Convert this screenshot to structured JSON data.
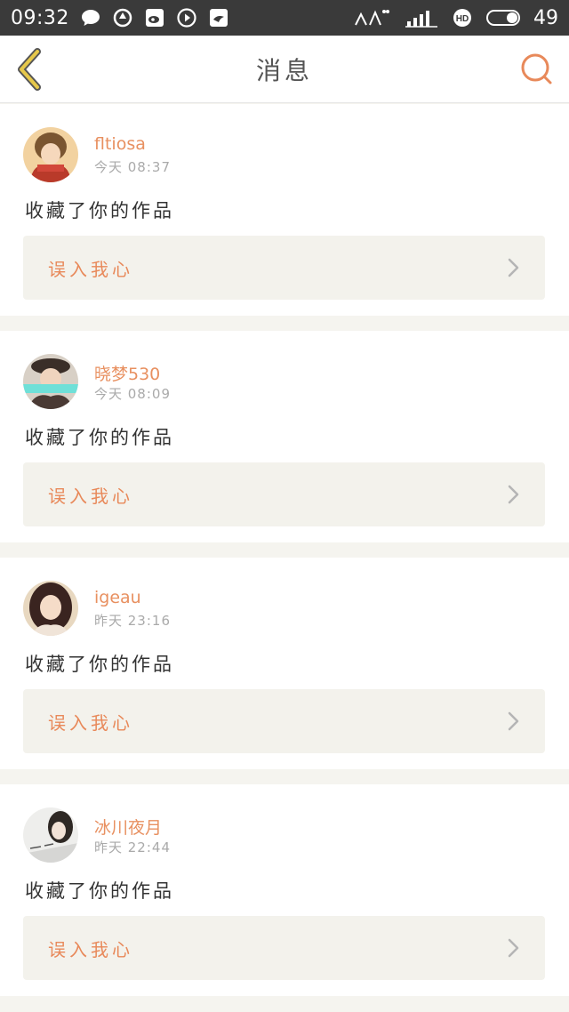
{
  "status_bar": {
    "time": "09:32",
    "battery_level": "49",
    "left_icons": [
      "chat-bubble-icon",
      "sync-icon",
      "weibo-icon",
      "play-icon",
      "app-icon"
    ],
    "right_icons": [
      "signal-icon",
      "hd-icon",
      "toggle-icon"
    ]
  },
  "header": {
    "back_icon": "chevron-left-icon",
    "title": "消息",
    "search_icon": "search-icon"
  },
  "colors": {
    "accent": "#e8895a",
    "username": "#e89060",
    "statusbar": "#3a3a3a",
    "back_icon": "#e6c84b"
  },
  "messages": [
    {
      "username": "fltiosa",
      "timestamp": "今天  08:37",
      "action": "收藏了你的作品",
      "work_title": "误入我心"
    },
    {
      "username": "晓梦530",
      "timestamp": "今天  08:09",
      "action": "收藏了你的作品",
      "work_title": "误入我心"
    },
    {
      "username": "igeau",
      "timestamp": "昨天  23:16",
      "action": "收藏了你的作品",
      "work_title": "误入我心"
    },
    {
      "username": "冰川夜月",
      "timestamp": "昨天  22:44",
      "action": "收藏了你的作品",
      "work_title": "误入我心"
    }
  ]
}
